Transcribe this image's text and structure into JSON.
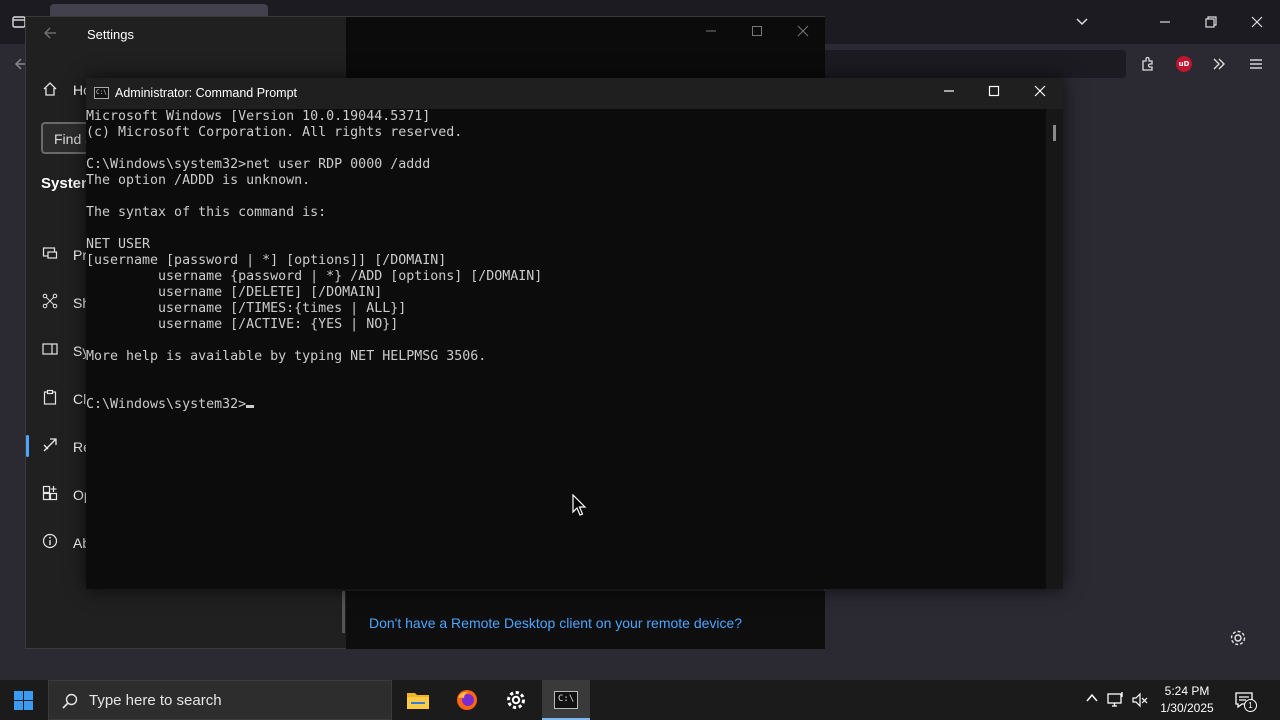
{
  "settings": {
    "title": "Settings",
    "find_placeholder": "Find a setting",
    "section_label": "System",
    "nav_items": [
      {
        "label": "Home",
        "icon": "home-icon"
      },
      {
        "label": "Projecting to this PC",
        "icon": "projecting-icon"
      },
      {
        "label": "Shared experiences",
        "icon": "shared-experiences-icon"
      },
      {
        "label": "System Components",
        "icon": "system-components-icon"
      },
      {
        "label": "Clipboard",
        "icon": "clipboard-icon"
      },
      {
        "label": "Remote Desktop",
        "icon": "remote-desktop-icon"
      },
      {
        "label": "Optional features",
        "icon": "optional-features-icon"
      },
      {
        "label": "About",
        "icon": "about-icon"
      }
    ],
    "remote_client_link": "Don't have a Remote Desktop client on your remote device?",
    "accent_color": "#4ca6ff"
  },
  "cmd": {
    "title": "Administrator: Command Prompt",
    "lines": [
      "Microsoft Windows [Version 10.0.19044.5371]",
      "(c) Microsoft Corporation. All rights reserved.",
      "",
      "C:\\Windows\\system32>net user RDP 0000 /addd",
      "The option /ADDD is unknown.",
      "",
      "The syntax of this command is:",
      "",
      "NET USER",
      "[username [password | *] [options]] [/DOMAIN]",
      "         username {password | *} /ADD [options] [/DOMAIN]",
      "         username [/DELETE] [/DOMAIN]",
      "         username [/TIMES:{times | ALL}]",
      "         username [/ACTIVE: {YES | NO}]",
      "",
      "More help is available by typing NET HELPMSG 3506.",
      "",
      ""
    ],
    "prompt": "C:\\Windows\\system32>",
    "text_color": "#cccccc",
    "background_color": "#0c0c0c"
  },
  "taskbar": {
    "search_placeholder": "Type here to search",
    "apps": [
      {
        "name": "file-explorer",
        "icon": "folder-icon"
      },
      {
        "name": "firefox",
        "icon": "firefox-icon"
      },
      {
        "name": "settings",
        "icon": "gear-icon"
      },
      {
        "name": "command-prompt",
        "icon": "cmd-icon",
        "label": "C:\\"
      }
    ],
    "clock_time": "5:24 PM",
    "clock_date": "1/30/2025",
    "notification_count": "1"
  }
}
